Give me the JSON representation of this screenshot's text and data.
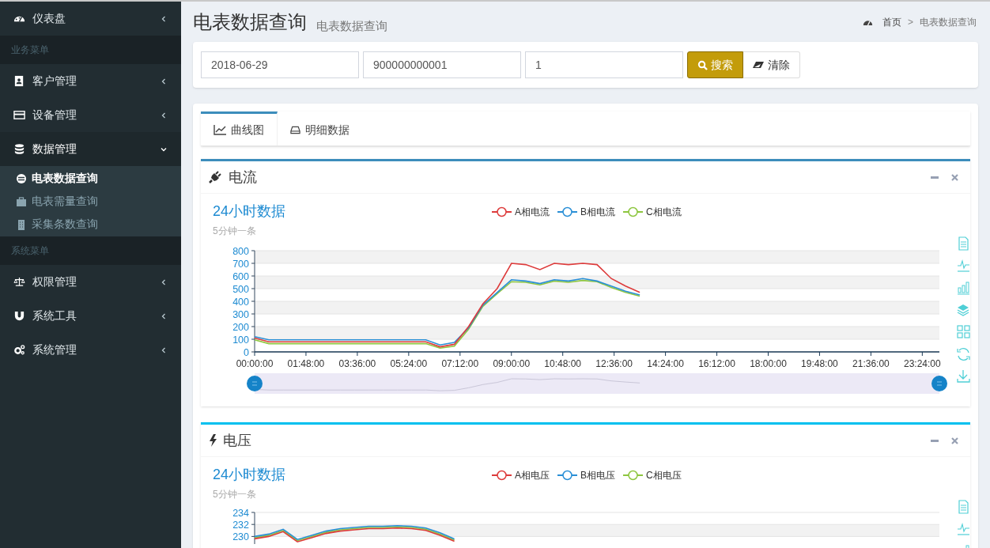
{
  "sidebar": [
    {
      "kind": "item",
      "label": "仪表盘",
      "expanded": false
    },
    {
      "kind": "header",
      "label": "业务菜单"
    },
    {
      "kind": "item",
      "label": "客户管理",
      "expanded": false
    },
    {
      "kind": "item",
      "label": "设备管理",
      "expanded": false
    },
    {
      "kind": "item",
      "label": "数据管理",
      "expanded": true,
      "children": [
        {
          "label": "电表数据查询",
          "selected": true
        },
        {
          "label": "电表需量查询",
          "selected": false
        },
        {
          "label": "采集条数查询",
          "selected": false
        }
      ]
    },
    {
      "kind": "header",
      "label": "系统菜单"
    },
    {
      "kind": "item",
      "label": "权限管理",
      "expanded": false
    },
    {
      "kind": "item",
      "label": "系统工具",
      "expanded": false
    },
    {
      "kind": "item",
      "label": "系统管理",
      "expanded": false
    }
  ],
  "header": {
    "title": "电表数据查询",
    "subtitle": "电表数据查询",
    "breadcrumb": [
      "首页",
      "电表数据查询"
    ],
    "separator": ">"
  },
  "search": {
    "fields": [
      "2018-06-29",
      "900000000001",
      "1"
    ],
    "buttons": [
      {
        "label": "搜索",
        "kind": "primary"
      },
      {
        "label": "清除",
        "kind": "default"
      }
    ]
  },
  "tabs": [
    {
      "label": "曲线图",
      "selected": true
    },
    {
      "label": "明细数据",
      "selected": false
    }
  ],
  "panels": [
    {
      "title": "电流",
      "chart_title": "24小时数据",
      "chart_subtitle": "5分钟一条",
      "chart_data": {
        "type": "line",
        "x": [
          0,
          30,
          60,
          90,
          120,
          150,
          180,
          210,
          240,
          270,
          300,
          330,
          360,
          390,
          420,
          450,
          480,
          510,
          540,
          570,
          600,
          630,
          660,
          690,
          720,
          750,
          780,
          810
        ],
        "xlim": [
          0,
          1440
        ],
        "ylim": [
          0,
          800
        ],
        "grid": true,
        "yticks": [
          0,
          100,
          200,
          300,
          400,
          500,
          600,
          700,
          800
        ],
        "xticks": [
          {
            "value": 0,
            "label": "00:00:00"
          },
          {
            "value": 108,
            "label": "01:48:00"
          },
          {
            "value": 216,
            "label": "03:36:00"
          },
          {
            "value": 324,
            "label": "05:24:00"
          },
          {
            "value": 432,
            "label": "07:12:00"
          },
          {
            "value": 540,
            "label": "09:00:00"
          },
          {
            "value": 648,
            "label": "10:48:00"
          },
          {
            "value": 756,
            "label": "12:36:00"
          },
          {
            "value": 864,
            "label": "14:24:00"
          },
          {
            "value": 972,
            "label": "16:12:00"
          },
          {
            "value": 1080,
            "label": "18:00:00"
          },
          {
            "value": 1188,
            "label": "19:48:00"
          },
          {
            "value": 1296,
            "label": "21:36:00"
          },
          {
            "value": 1404,
            "label": "23:24:00"
          }
        ],
        "series": [
          {
            "name": "A相电流",
            "color": "#dd3b3b",
            "values": [
              110,
              80,
              80,
              80,
              80,
              80,
              80,
              80,
              80,
              80,
              80,
              80,
              80,
              40,
              60,
              200,
              380,
              500,
              700,
              690,
              650,
              700,
              690,
              700,
              690,
              580,
              520,
              470
            ]
          },
          {
            "name": "B相电流",
            "color": "#2a8fd6",
            "values": [
              120,
              95,
              95,
              95,
              95,
              95,
              95,
              95,
              95,
              95,
              95,
              95,
              95,
              55,
              75,
              190,
              370,
              470,
              570,
              560,
              540,
              570,
              560,
              580,
              560,
              520,
              480,
              450
            ]
          },
          {
            "name": "C相电流",
            "color": "#8dc63f",
            "values": [
              95,
              65,
              65,
              65,
              65,
              65,
              65,
              65,
              65,
              65,
              65,
              65,
              65,
              30,
              45,
              180,
              360,
              460,
              555,
              550,
              530,
              560,
              550,
              565,
              555,
              510,
              470,
              440
            ]
          }
        ]
      }
    },
    {
      "title": "电压",
      "chart_title": "24小时数据",
      "chart_subtitle": "5分钟一条",
      "chart_data": {
        "type": "line",
        "x": [
          0,
          30,
          60,
          90,
          120,
          150,
          180,
          210,
          240,
          270,
          300,
          330,
          360,
          390,
          420
        ],
        "xlim": [
          0,
          1440
        ],
        "ylim": [
          229,
          234
        ],
        "grid": true,
        "yticks": [
          230,
          232,
          234
        ],
        "series": [
          {
            "name": "A相电压",
            "color": "#dd3b3b",
            "values": [
              229.6,
              230.0,
              230.8,
              229.1,
              229.8,
              230.5,
              230.9,
              231.1,
              231.3,
              231.3,
              231.4,
              231.3,
              231.0,
              230.2,
              229.2
            ]
          },
          {
            "name": "B相电压",
            "color": "#2a8fd6",
            "values": [
              230.0,
              230.4,
              231.2,
              229.5,
              230.2,
              230.9,
              231.3,
              231.5,
              231.7,
              231.7,
              231.8,
              231.7,
              231.4,
              230.6,
              229.6
            ]
          },
          {
            "name": "C相电压",
            "color": "#8dc63f",
            "values": [
              229.8,
              230.2,
              231.0,
              229.3,
              230.0,
              230.7,
              231.1,
              231.3,
              231.5,
              231.5,
              231.6,
              231.5,
              231.2,
              230.4,
              229.4
            ]
          }
        ]
      }
    }
  ]
}
